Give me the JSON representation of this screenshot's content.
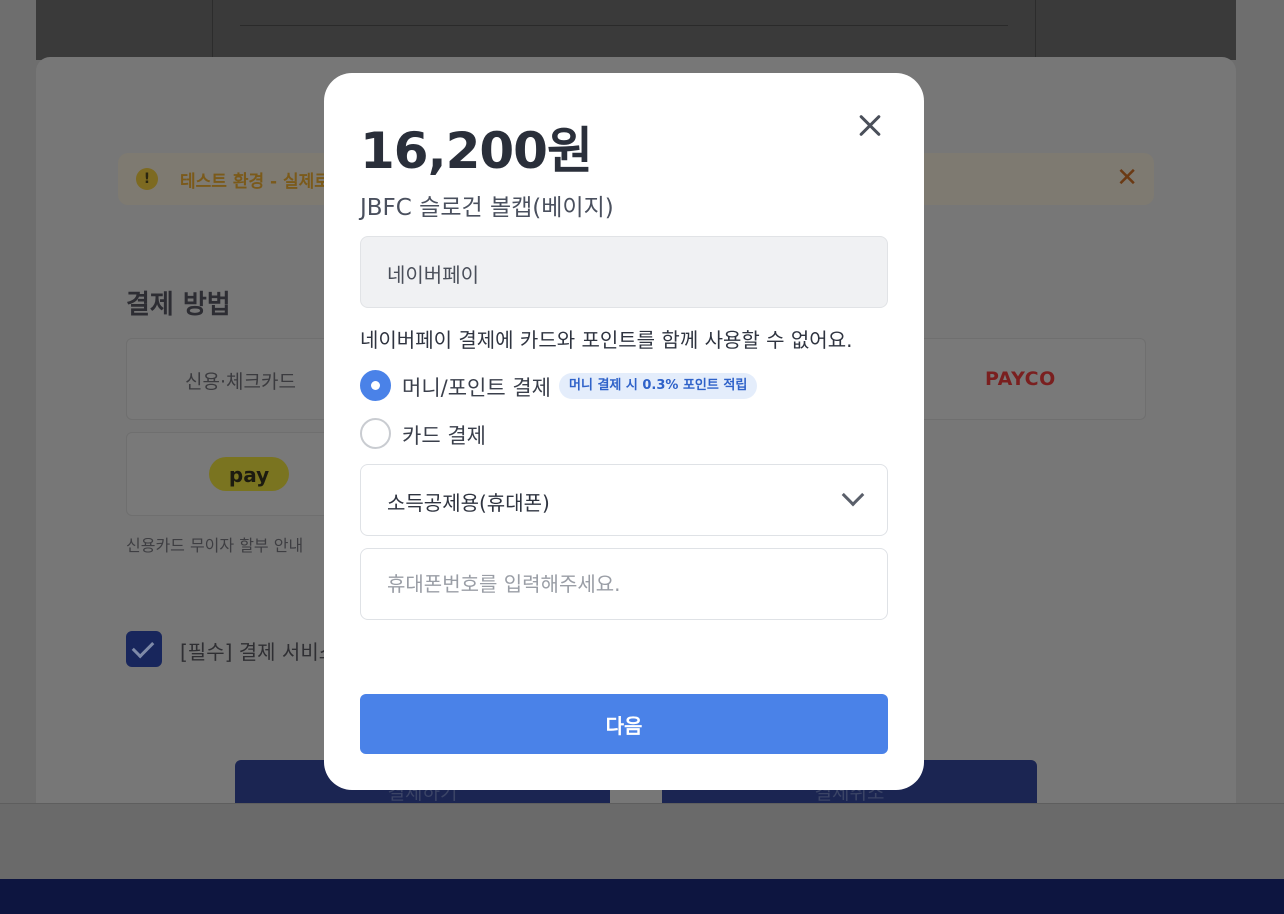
{
  "background": {
    "notice": {
      "text": "테스트 환경 - 실제로"
    },
    "section_title": "결제 방법",
    "methods": {
      "card": "신용·체크카드",
      "payco": "PAYCO",
      "kakaopay": "pay"
    },
    "installment_text": "신용카드 무이자 할부 안내",
    "agreement_text": "[필수] 결제 서비스",
    "buttons": {
      "pay": "결제하기",
      "cancel": "결제취소"
    }
  },
  "modal": {
    "amount": "16,200원",
    "product_name": "JBFC 슬로건 볼캡(베이지)",
    "payment_method": "네이버페이",
    "warning": "네이버페이 결제에 카드와 포인트를 함께 사용할 수 없어요.",
    "options": [
      {
        "label": "머니/포인트 결제",
        "badge": "머니 결제 시 0.3% 포인트 적립",
        "selected": true
      },
      {
        "label": "카드 결제",
        "selected": false
      }
    ],
    "receipt_select": {
      "value": "소득공제용(휴대폰)"
    },
    "phone_input": {
      "value": "",
      "placeholder": "휴대폰번호를 입력해주세요."
    },
    "next_button": "다음"
  },
  "colors": {
    "primary": "#4a82e8",
    "badge_bg": "#e4edfb",
    "badge_text": "#2f62c9",
    "dark_navy": "#0d1540"
  }
}
